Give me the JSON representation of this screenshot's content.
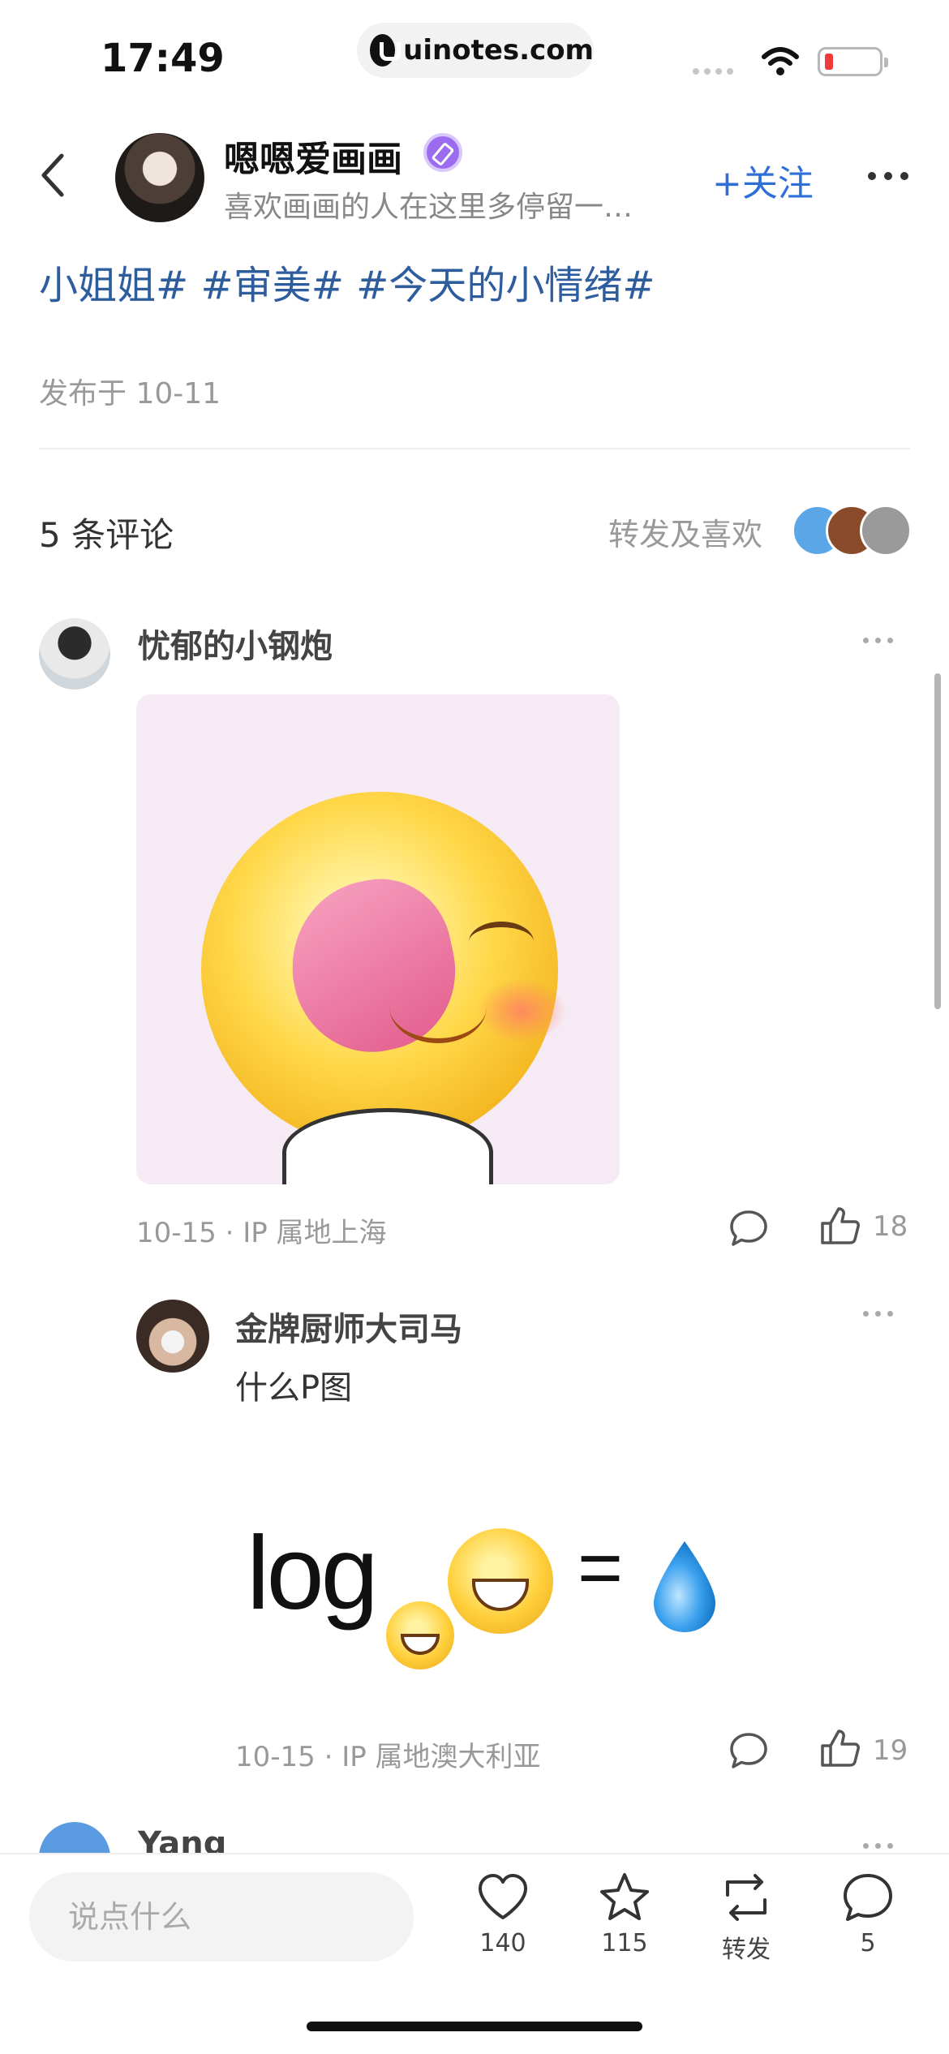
{
  "status_bar": {
    "time": "17:49",
    "url": "uinotes.com"
  },
  "header": {
    "author_name": "嗯嗯爱画画",
    "author_bio": "喜欢画画的人在这里多停留一…",
    "follow_label": "+关注"
  },
  "post": {
    "tags": "小姐姐# #审美# #今天的小情绪#",
    "publish_date": "发布于 10-11"
  },
  "comments_section": {
    "count_label": "5 条评论",
    "reposts_label": "转发及喜欢"
  },
  "comments": [
    {
      "name": "忧郁的小钢炮",
      "meta": "10-15 · IP 属地上海",
      "likes": "18",
      "image_icon": "tongue-out-emoji",
      "reply": {
        "name": "金牌厨师大司马",
        "text": "什么P图",
        "image": {
          "log_text": "log",
          "equals": "=",
          "icons": [
            "grin-emoji",
            "sweat-smile-emoji",
            "droplet-icon"
          ]
        },
        "meta": "10-15 · IP 属地澳大利亚",
        "likes": "19"
      }
    },
    {
      "name": "Yang"
    }
  ],
  "bottom_bar": {
    "input_placeholder": "说点什么",
    "like_count": "140",
    "favorite_count": "115",
    "repost_label": "转发",
    "comment_count": "5"
  },
  "colors": {
    "accent_blue": "#2f6fd8",
    "tag_blue": "#2e5d9d",
    "verify_purple": "#9b6bf0",
    "battery_low": "#ef3b3b"
  }
}
